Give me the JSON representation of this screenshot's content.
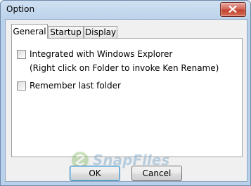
{
  "window": {
    "title": "Option"
  },
  "tabs": [
    {
      "label": "General",
      "active": true
    },
    {
      "label": "Startup",
      "active": false
    },
    {
      "label": "Display",
      "active": false
    }
  ],
  "general": {
    "explorer_label": "Integrated with Windows Explorer",
    "explorer_hint": "(Right click on Folder to invoke Ken Rename)",
    "explorer_checked": false,
    "remember_label": "Remember last folder",
    "remember_checked": false
  },
  "buttons": {
    "ok": "OK",
    "cancel": "Cancel"
  },
  "watermark": {
    "text": "SnapFiles"
  },
  "colors": {
    "title_bar": "#b9d1ea",
    "close": "#c0432f",
    "accent": "#3c7fb1"
  }
}
